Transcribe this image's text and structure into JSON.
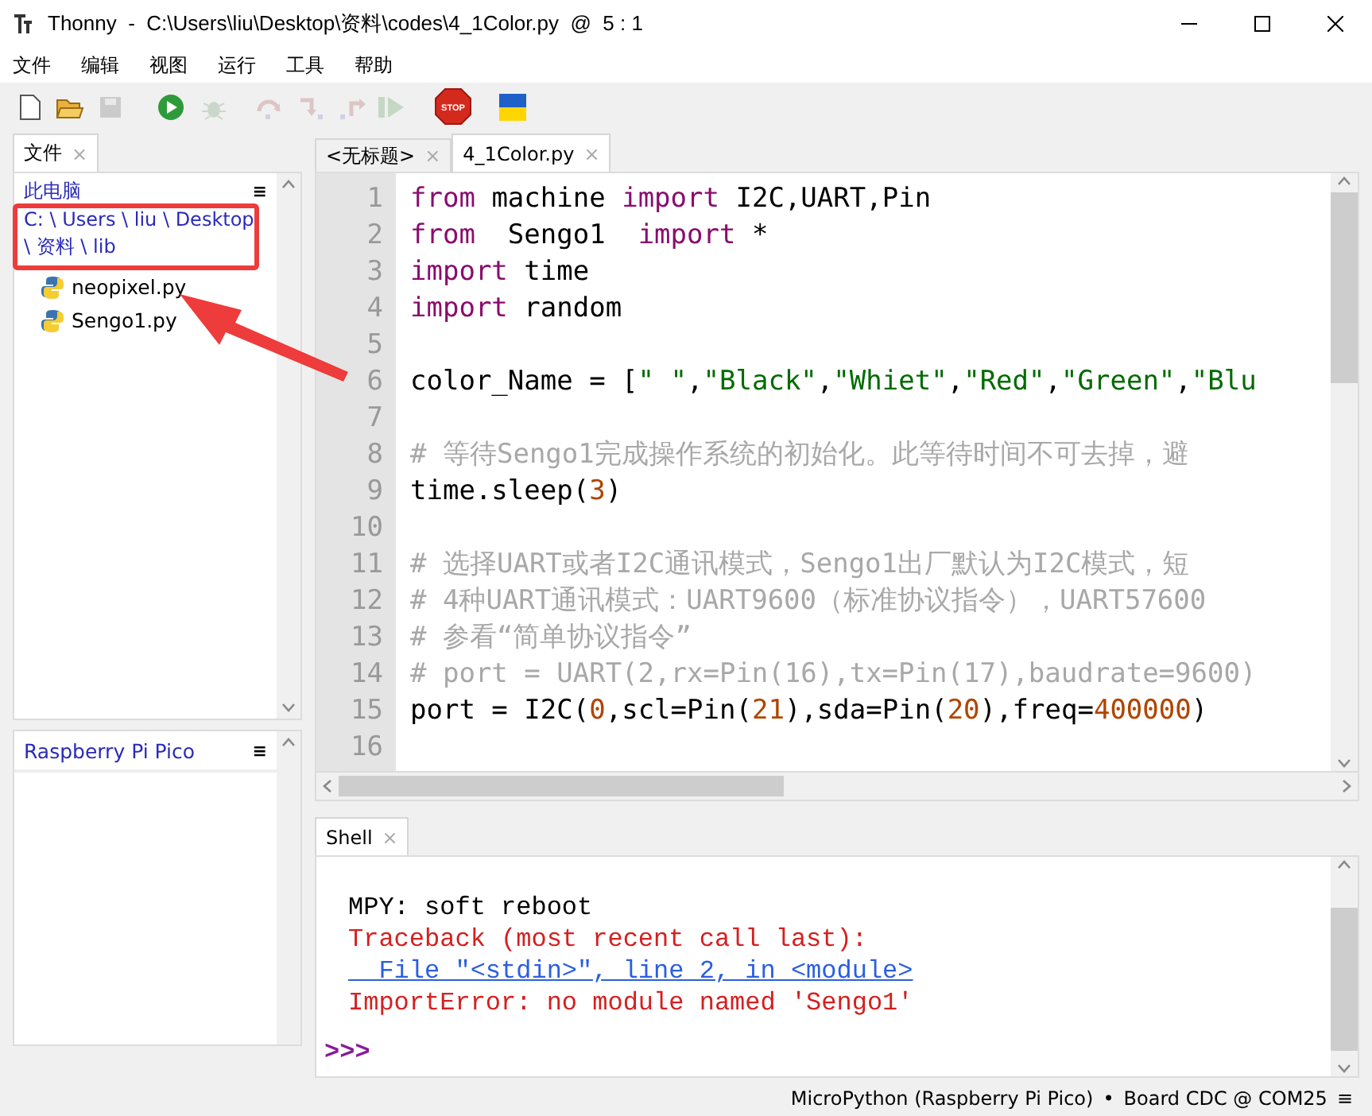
{
  "window": {
    "title": "Thonny  -  C:\\Users\\liu\\Desktop\\资料\\codes\\4_1Color.py  @  5 : 1"
  },
  "menu": [
    "文件",
    "编辑",
    "视图",
    "运行",
    "工具",
    "帮助"
  ],
  "toolbar": [
    {
      "kind": "new",
      "disabled": false
    },
    {
      "kind": "open",
      "disabled": false
    },
    {
      "kind": "save",
      "disabled": true
    },
    {
      "kind": "run",
      "disabled": false
    },
    {
      "kind": "debug",
      "disabled": true
    },
    {
      "kind": "step_over",
      "disabled": true
    },
    {
      "kind": "step_into",
      "disabled": true
    },
    {
      "kind": "step_out",
      "disabled": true
    },
    {
      "kind": "resume",
      "disabled": true
    },
    {
      "kind": "stop",
      "disabled": false,
      "label": "STOP"
    },
    {
      "kind": "flag",
      "disabled": false
    }
  ],
  "files_panel": {
    "tab": {
      "label": "文件",
      "close": "×"
    },
    "header": "此电脑",
    "menu_glyph": "≡",
    "path": "C: \\ Users \\ liu \\ Desktop \\ 资料 \\ lib",
    "files": [
      {
        "name": "neopixel.py"
      },
      {
        "name": "Sengo1.py"
      }
    ]
  },
  "device_panel": {
    "title": "Raspberry Pi Pico",
    "menu_glyph": "≡"
  },
  "editor": {
    "tabs": [
      {
        "label": "<无标题>",
        "close": "×",
        "selected": false
      },
      {
        "label": "4_1Color.py",
        "close": "×",
        "selected": true
      }
    ],
    "lines": [
      {
        "number": "1",
        "tokens": [
          {
            "kind": "keyword",
            "text": "from"
          },
          {
            "kind": "plain",
            "text": " machine "
          },
          {
            "kind": "keyword",
            "text": "import"
          },
          {
            "kind": "plain",
            "text": " I2C,UART,Pin"
          }
        ]
      },
      {
        "number": "2",
        "tokens": [
          {
            "kind": "keyword",
            "text": "from"
          },
          {
            "kind": "plain",
            "text": "  Sengo1  "
          },
          {
            "kind": "keyword",
            "text": "import"
          },
          {
            "kind": "plain",
            "text": " *"
          }
        ]
      },
      {
        "number": "3",
        "tokens": [
          {
            "kind": "keyword",
            "text": "import"
          },
          {
            "kind": "plain",
            "text": " time"
          }
        ]
      },
      {
        "number": "4",
        "tokens": [
          {
            "kind": "keyword",
            "text": "import"
          },
          {
            "kind": "plain",
            "text": " random"
          }
        ]
      },
      {
        "number": "5"
      },
      {
        "number": "6",
        "tokens": [
          {
            "kind": "plain",
            "text": "color_Name = ["
          },
          {
            "kind": "string",
            "text": "\" \""
          },
          {
            "kind": "plain",
            "text": ","
          },
          {
            "kind": "string",
            "text": "\"Black\""
          },
          {
            "kind": "plain",
            "text": ","
          },
          {
            "kind": "string",
            "text": "\"Whiet\""
          },
          {
            "kind": "plain",
            "text": ","
          },
          {
            "kind": "string",
            "text": "\"Red\""
          },
          {
            "kind": "plain",
            "text": ","
          },
          {
            "kind": "string",
            "text": "\"Green\""
          },
          {
            "kind": "plain",
            "text": ","
          },
          {
            "kind": "string",
            "text": "\"Blu"
          }
        ]
      },
      {
        "number": "7"
      },
      {
        "number": "8",
        "tokens": [
          {
            "kind": "comment",
            "text": "# 等待Sengo1完成操作系统的初始化。此等待时间不可去掉，避"
          }
        ]
      },
      {
        "number": "9",
        "tokens": [
          {
            "kind": "plain",
            "text": "time.sleep("
          },
          {
            "kind": "number",
            "text": "3"
          },
          {
            "kind": "plain",
            "text": ")"
          }
        ]
      },
      {
        "number": "10"
      },
      {
        "number": "11",
        "tokens": [
          {
            "kind": "comment",
            "text": "# 选择UART或者I2C通讯模式，Sengo1出厂默认为I2C模式，短"
          }
        ]
      },
      {
        "number": "12",
        "tokens": [
          {
            "kind": "comment",
            "text": "# 4种UART通讯模式：UART9600（标准协议指令），UART57600"
          }
        ]
      },
      {
        "number": "13",
        "tokens": [
          {
            "kind": "comment",
            "text": "# 参看“简单协议指令”"
          }
        ]
      },
      {
        "number": "14",
        "tokens": [
          {
            "kind": "comment",
            "text": "# port = UART(2,rx=Pin(16),tx=Pin(17),baudrate=9600)"
          }
        ]
      },
      {
        "number": "15",
        "tokens": [
          {
            "kind": "plain",
            "text": "port = I2C("
          },
          {
            "kind": "number",
            "text": "0"
          },
          {
            "kind": "plain",
            "text": ",scl=Pin("
          },
          {
            "kind": "number",
            "text": "21"
          },
          {
            "kind": "plain",
            "text": "),sda=Pin("
          },
          {
            "kind": "number",
            "text": "20"
          },
          {
            "kind": "plain",
            "text": "),freq="
          },
          {
            "kind": "number",
            "text": "400000"
          },
          {
            "kind": "plain",
            "text": ")"
          }
        ]
      },
      {
        "number": "16"
      }
    ]
  },
  "shell": {
    "tab": {
      "label": "Shell",
      "close": "×"
    },
    "lines": [
      {
        "kind": "output",
        "text": "MPY: soft reboot"
      },
      {
        "kind": "error",
        "text": "Traceback (most recent call last):"
      },
      {
        "kind": "link",
        "text": "  File \"<stdin>\", line 2, in <module>"
      },
      {
        "kind": "error",
        "text": "ImportError: no module named 'Sengo1'"
      }
    ],
    "prompt": ">>>"
  },
  "status_bar": {
    "interpreter": "MicroPython (Raspberry Pi Pico)",
    "separator": "•",
    "port": "Board CDC @ COM25",
    "menu_glyph": "≡"
  }
}
